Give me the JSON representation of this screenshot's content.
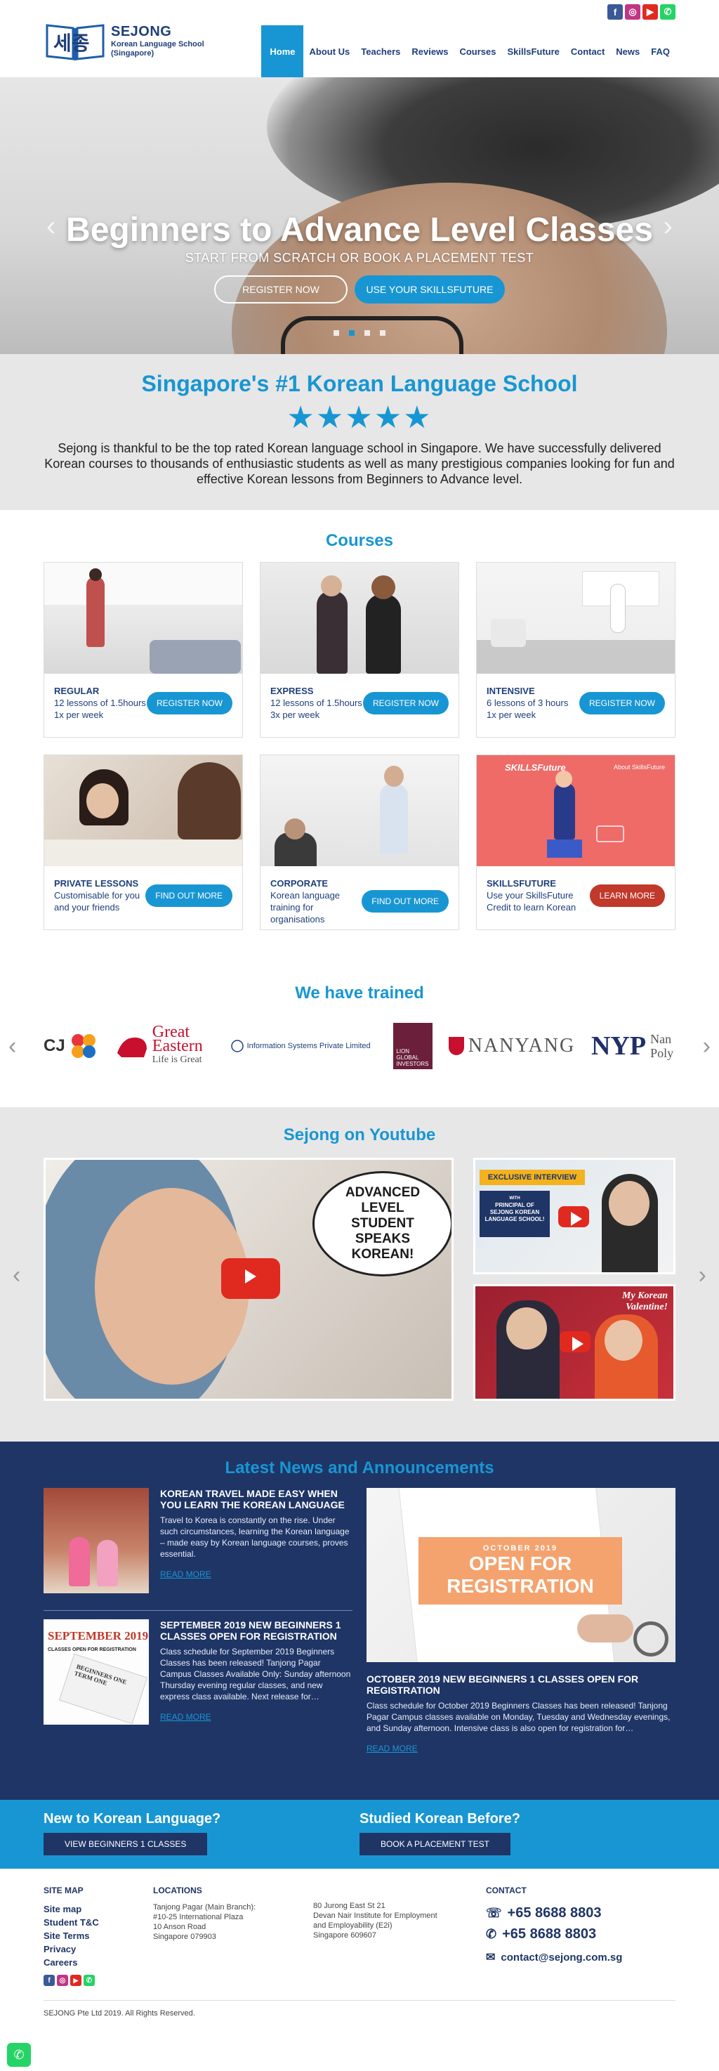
{
  "brand": {
    "logo_korean": "세종",
    "name": "SEJONG",
    "tagline1": "Korean Language School",
    "tagline2": "(Singapore)"
  },
  "social": {
    "facebook": "f",
    "instagram": "◎",
    "youtube": "▶",
    "whatsapp": "✆"
  },
  "nav": {
    "items": [
      "Home",
      "About Us",
      "Teachers",
      "Reviews",
      "Courses",
      "SkillsFuture",
      "Contact",
      "News",
      "FAQ"
    ],
    "active": "Home"
  },
  "hero": {
    "title": "Beginners to Advance Level Classes",
    "subtitle": "START FROM SCRATCH OR BOOK A PLACEMENT TEST",
    "register_btn": "REGISTER NOW",
    "skillsfuture_btn": "USE YOUR SKILLSFUTURE",
    "slide_count": 4,
    "active_slide": 2
  },
  "intro": {
    "title": "Singapore's #1 Korean Language School",
    "rating_stars": 5,
    "description": "Sejong is thankful to be the top rated Korean language school in Singapore. We have successfully delivered Korean courses to thousands of enthusiastic students as well as many prestigious companies looking for fun and effective Korean lessons from Beginners to Advance level."
  },
  "courses": {
    "title": "Courses",
    "items": [
      {
        "name": "REGULAR",
        "line1": "12 lessons of 1.5hours",
        "line2": "1x per week",
        "line3": "",
        "button": "REGISTER NOW"
      },
      {
        "name": "EXPRESS",
        "line1": "12 lessons of 1.5hours",
        "line2": "3x per week",
        "line3": "",
        "button": "REGISTER NOW"
      },
      {
        "name": "INTENSIVE",
        "line1": "6 lessons of 3 hours",
        "line2": "1x per week",
        "line3": "",
        "button": "REGISTER NOW"
      },
      {
        "name": "PRIVATE LESSONS",
        "line1": "Customisable for you",
        "line2": "and your friends",
        "line3": "",
        "button": "FIND OUT MORE"
      },
      {
        "name": "CORPORATE",
        "line1": "Korean language",
        "line2": "training for",
        "line3": "organisations",
        "button": "FIND OUT MORE"
      },
      {
        "name": "SKILLSFUTURE",
        "line1": "Use your SkillsFuture",
        "line2": "Credit to learn Korean",
        "line3": "",
        "button": "LEARN MORE"
      }
    ],
    "skillsfuture_banner": "SKILLSFuture",
    "skillsfuture_about": "About SkillsFuture"
  },
  "trained": {
    "title": "We have trained",
    "logos": {
      "cj": "CJ",
      "great_eastern1": "Great",
      "great_eastern2": "Eastern",
      "great_eastern3": "Life is Great",
      "isp": "Information Systems Private Limited",
      "lion1": "LION",
      "lion2": "GLOBAL",
      "lion3": "INVESTORS",
      "nanyang": "NANYANG",
      "nyp": "NYP",
      "nyp_text1": "Nan",
      "nyp_text2": "Poly"
    }
  },
  "youtube": {
    "title": "Sejong on Youtube",
    "main_bubble": "ADVANCED LEVEL STUDENT SPEAKS KOREAN!",
    "side1_banner": "EXCLUSIVE INTERVIEW",
    "side1_text": "PRINCIPAL OF SEJONG KOREAN LANGUAGE SCHOOL!",
    "side1_with": "WITH",
    "side2_text": "My Korean Valentine!"
  },
  "news": {
    "title": "Latest News and Announcements",
    "items": [
      {
        "title": "KOREAN TRAVEL MADE EASY WHEN YOU LEARN THE KOREAN LANGUAGE",
        "excerpt": "Travel to Korea is constantly on the rise. Under such circumstances, learning the Korean language – made easy by Korean language courses, proves essential.",
        "link": "READ MORE"
      },
      {
        "title": "SEPTEMBER 2019 NEW BEGINNERS 1 CLASSES OPEN FOR REGISTRATION",
        "excerpt": "Class schedule for September 2019 Beginners Classes has been released! Tanjong Pagar Campus Classes Available Only: Sunday afternoon Thursday evening regular classes, and new express class available. Next release for…",
        "link": "READ MORE"
      }
    ],
    "thumb2_line1": "SEPTEMBER 2019",
    "thumb2_line2": "CLASSES OPEN FOR REGISTRATION",
    "thumb2_line3": "BEGINNERS ONE",
    "thumb2_line4": "TERM ONE",
    "feature": {
      "banner_small": "OCTOBER 2019",
      "banner_big1": "OPEN FOR",
      "banner_big2": "REGISTRATION",
      "title": "OCTOBER 2019 NEW BEGINNERS 1 CLASSES OPEN FOR REGISTRATION",
      "excerpt": "Class schedule for October 2019 Beginners Classes has been released! Tanjong Pagar Campus classes available on Monday, Tuesday and Wednesday evenings, and Sunday afternoon. Intensive class is also open for registration for…",
      "link": "READ MORE"
    }
  },
  "cta": {
    "new_title": "New to Korean Language?",
    "new_btn": "VIEW BEGINNERS 1 CLASSES",
    "studied_title": "Studied Korean Before?",
    "studied_btn": "BOOK A PLACEMENT TEST"
  },
  "footer": {
    "sitemap_title": "SITE MAP",
    "sitemap": [
      "Site map",
      "Student T&C",
      "Site Terms",
      "Privacy",
      "Careers"
    ],
    "locations_title": "LOCATIONS",
    "loc1": [
      "Tanjong Pagar (Main Branch):",
      "#10-25 International Plaza",
      "10 Anson Road",
      "Singapore 079903"
    ],
    "loc2": [
      "80 Jurong East St 21",
      "Devan Nair Institute for Employment",
      "and Employability (E2i)",
      "Singapore 609607"
    ],
    "contact_title": "CONTACT",
    "phone": "+65 8688 8803",
    "whatsapp": "+65 8688 8803",
    "email": "contact@sejong.com.sg",
    "copyright": "SEJONG Pte Ltd 2019. All Rights Reserved."
  },
  "colors": {
    "primary": "#1896d3",
    "navy": "#1f3566",
    "grey_band": "#e7e7e7"
  }
}
